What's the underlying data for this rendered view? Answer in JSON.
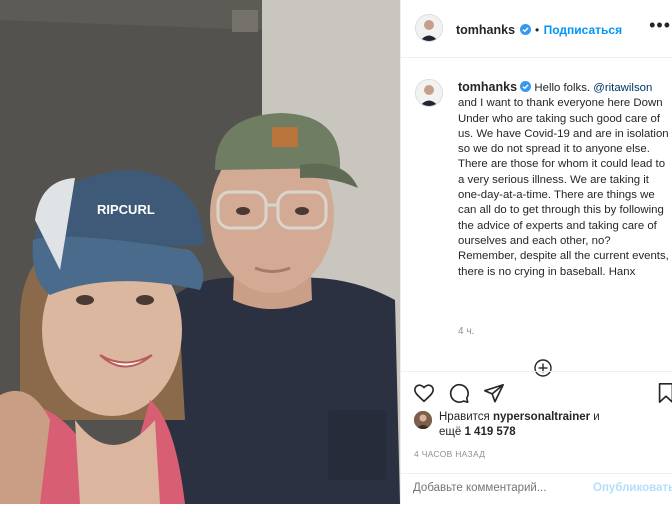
{
  "post": {
    "username": "tomhanks",
    "follow_label": "Подписаться",
    "dot": "•",
    "more": "•••",
    "caption_username": "tomhanks",
    "caption_before_mention": "Hello folks. ",
    "caption_mention": "@ritawilson",
    "caption_after_mention": " and I want to thank everyone here Down Under who are taking such good care of us. We have Covid-19 and are in isolation so we do not spread it to anyone else. There are those for whom it could lead to a very serious illness. We are taking it one-day-at-a-time. There are things we can all do to get through this by following the advice of experts and taking care of ourselves and each other, no? Remember, despite all the current events, there is no crying in baseball. Hanx",
    "caption_age": "4 ч.",
    "likes_prefix": "Нравится ",
    "likes_user": "nypersonaltrainer",
    "likes_and": " и",
    "likes_more_prefix": "ещё ",
    "likes_count": "1 419 578",
    "timestamp": "4 ЧАСОВ НАЗАД"
  },
  "photo": {
    "cap_left_text": "RIPCURL"
  },
  "comment": {
    "placeholder": "Добавьте комментарий...",
    "publish_label": "Опубликовать"
  },
  "icons": {
    "verified": "verified-badge-icon",
    "like": "heart-icon",
    "comment": "comment-icon",
    "share": "paper-plane-icon",
    "save": "bookmark-icon",
    "load_more": "plus-circle-icon"
  },
  "colors": {
    "accent_blue": "#0095f6",
    "verified_blue": "#3897f0",
    "muted_gray": "#8e8e8e",
    "publish_disabled": "#b2dffc",
    "mention": "#00376b"
  }
}
